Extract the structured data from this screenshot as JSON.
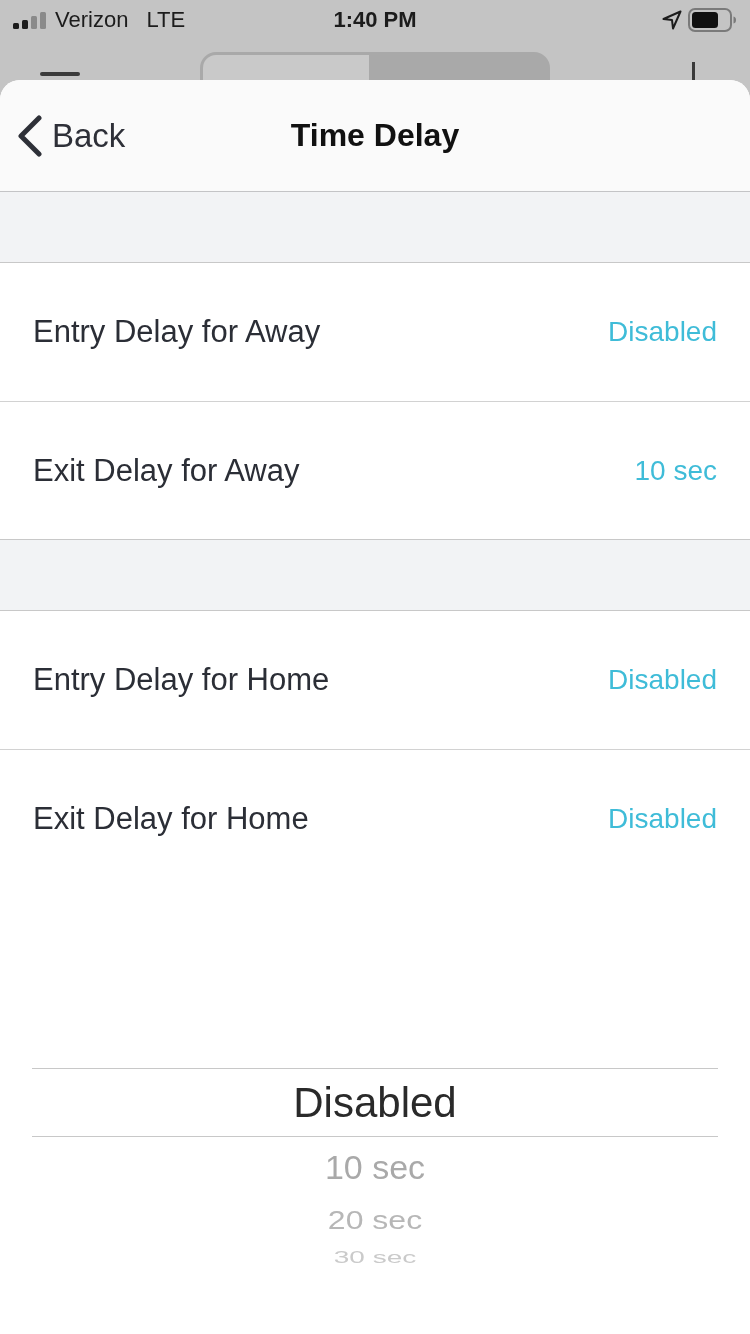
{
  "status_bar": {
    "carrier": "Verizon",
    "network": "LTE",
    "time": "1:40 PM"
  },
  "background_segments": [
    {
      "selected": true
    },
    {
      "selected": false
    }
  ],
  "nav": {
    "back": "Back",
    "title": "Time Delay"
  },
  "sections": [
    {
      "rows": [
        {
          "label": "Entry Delay for Away",
          "value": "Disabled"
        },
        {
          "label": "Exit Delay for Away",
          "value": "10 sec"
        }
      ]
    },
    {
      "rows": [
        {
          "label": "Entry Delay for Home",
          "value": "Disabled"
        },
        {
          "label": "Exit Delay for Home",
          "value": "Disabled"
        }
      ]
    }
  ],
  "picker": {
    "options": [
      {
        "label": "Disabled",
        "selected": true
      },
      {
        "label": "10 sec",
        "selected": false
      },
      {
        "label": "20 sec",
        "selected": false
      },
      {
        "label": "30 sec",
        "selected": false
      }
    ]
  }
}
